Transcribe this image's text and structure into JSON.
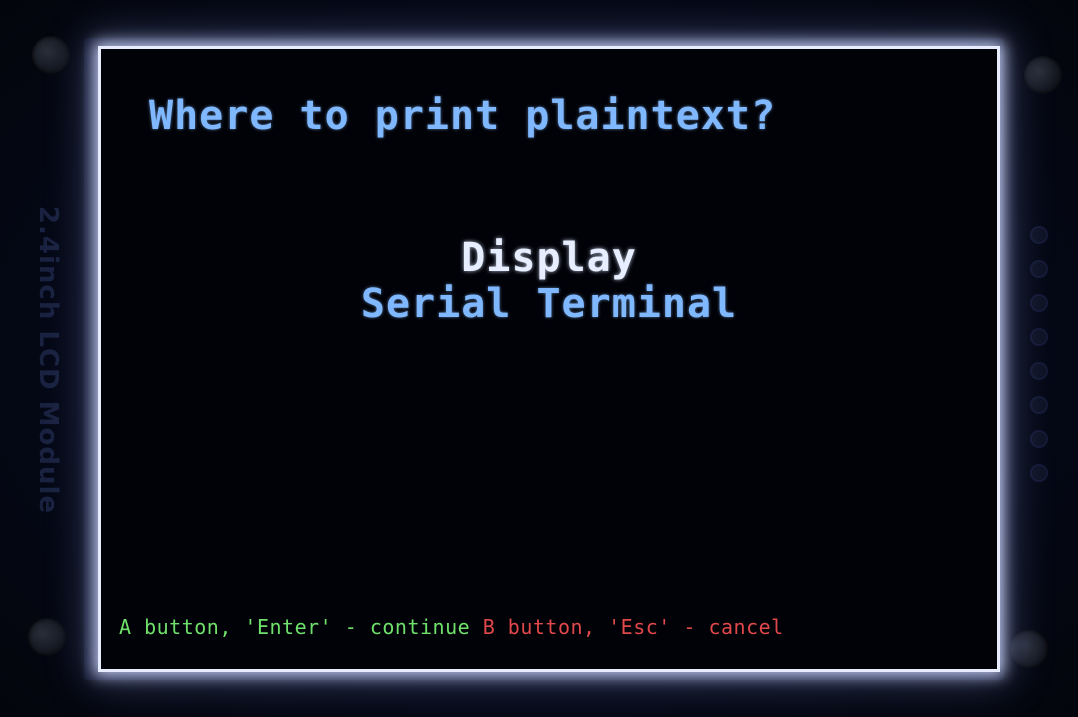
{
  "module_label": "2.4inch LCD Module",
  "screen": {
    "prompt": "Where to print plaintext?",
    "options": [
      {
        "label": "Display",
        "selected": true
      },
      {
        "label": "Serial Terminal",
        "selected": false
      }
    ],
    "footer": {
      "continue_hint": "A button, 'Enter' - continue",
      "cancel_hint": "B button, 'Esc' - cancel"
    }
  },
  "colors": {
    "prompt": "#7fb8ff",
    "selected_option": "#e6eeff",
    "option": "#7fb8ff",
    "continue_hint": "#6fe06a",
    "cancel_hint": "#e0484a",
    "screen_background": "#000208"
  }
}
